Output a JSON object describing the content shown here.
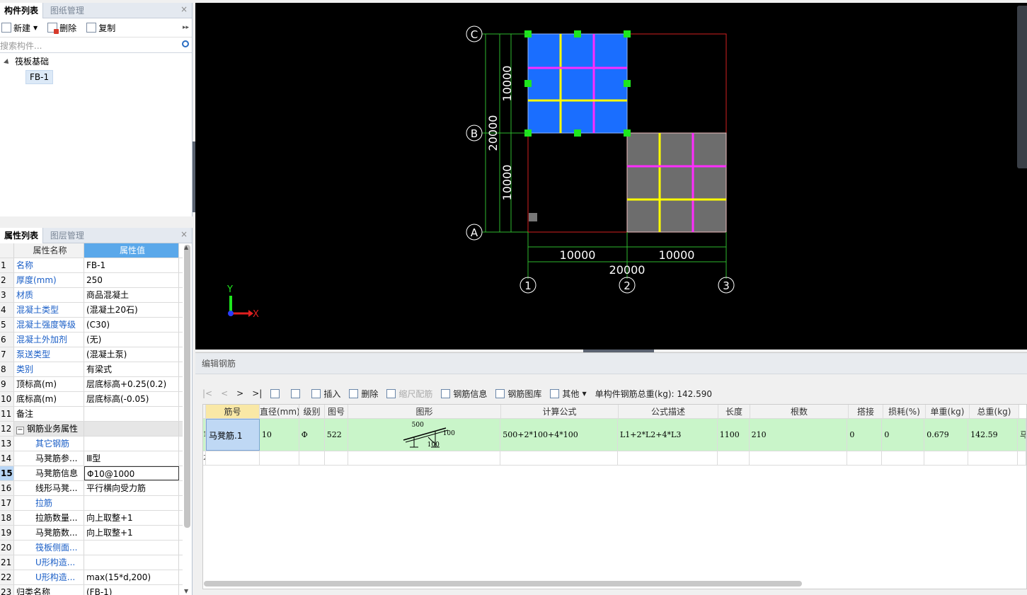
{
  "component_panel": {
    "tabs": [
      "构件列表",
      "图纸管理"
    ],
    "toolbar": {
      "new": "新建",
      "delete": "删除",
      "copy": "复制"
    },
    "search_placeholder": "搜索构件...",
    "tree": {
      "root": "筏板基础",
      "child": "FB-1"
    }
  },
  "property_panel": {
    "tabs": [
      "属性列表",
      "图层管理"
    ],
    "header": {
      "name": "属性名称",
      "value": "属性值"
    },
    "rows": [
      {
        "num": "1",
        "name": "名称",
        "value": "FB-1"
      },
      {
        "num": "2",
        "name": "厚度(mm)",
        "value": "250"
      },
      {
        "num": "3",
        "name": "材质",
        "value": "商品混凝土"
      },
      {
        "num": "4",
        "name": "混凝土类型",
        "value": "(混凝土20石)"
      },
      {
        "num": "5",
        "name": "混凝土强度等级",
        "value": "(C30)"
      },
      {
        "num": "6",
        "name": "混凝土外加剂",
        "value": "(无)"
      },
      {
        "num": "7",
        "name": "泵送类型",
        "value": "(混凝土泵)"
      },
      {
        "num": "8",
        "name": "类别",
        "value": "有梁式"
      },
      {
        "num": "9",
        "name": "顶标高(m)",
        "value": "层底标高+0.25(0.2)"
      },
      {
        "num": "10",
        "name": "底标高(m)",
        "value": "层底标高(-0.05)"
      },
      {
        "num": "11",
        "name": "备注",
        "value": ""
      },
      {
        "num": "12",
        "name": "钢筋业务属性",
        "value": ""
      },
      {
        "num": "13",
        "name": "其它钢筋",
        "value": ""
      },
      {
        "num": "14",
        "name": "马凳筋参...",
        "value": "Ⅲ型"
      },
      {
        "num": "15",
        "name": "马凳筋信息",
        "value": "Φ10@1000"
      },
      {
        "num": "16",
        "name": "线形马凳...",
        "value": "平行横向受力筋"
      },
      {
        "num": "17",
        "name": "拉筋",
        "value": ""
      },
      {
        "num": "18",
        "name": "拉筋数量...",
        "value": "向上取整+1"
      },
      {
        "num": "19",
        "name": "马凳筋数...",
        "value": "向上取整+1"
      },
      {
        "num": "20",
        "name": "筏板侧面...",
        "value": ""
      },
      {
        "num": "21",
        "name": "U形构造...",
        "value": ""
      },
      {
        "num": "22",
        "name": "U形构造...",
        "value": "max(15*d,200)"
      },
      {
        "num": "23",
        "name": "归类名称",
        "value": "(FB-1)"
      }
    ]
  },
  "canvas": {
    "axis_rows": [
      "C",
      "B",
      "A"
    ],
    "axis_cols": [
      "1",
      "2",
      "3"
    ],
    "dims_vertical": [
      "10000",
      "10000",
      "20000"
    ],
    "dims_horizontal": [
      "10000",
      "10000",
      "20000"
    ],
    "axis_x": "X",
    "axis_y": "Y"
  },
  "editor": {
    "title": "编辑钢筋",
    "toolbar": {
      "insert": "插入",
      "delete": "删除",
      "scale": "缩尺配筋",
      "info": "钢筋信息",
      "library": "钢筋图库",
      "other": "其他",
      "total_label": "单构件钢筋总重(kg): 142.590"
    },
    "columns": [
      "筋号",
      "直径(mm)",
      "级别",
      "图号",
      "图形",
      "计算公式",
      "公式描述",
      "长度",
      "根数",
      "搭接",
      "损耗(%)",
      "单重(kg)",
      "总重(kg)"
    ],
    "rows": [
      {
        "num": "1",
        "name": "马凳筋.1",
        "dia": "10",
        "grade": "Φ",
        "fig": "522",
        "shape_top": "500",
        "shape_right": "100",
        "shape_bottom": "100",
        "formula": "500+2*100+4*100",
        "desc": "L1+2*L2+4*L3",
        "length": "1100",
        "count": "210",
        "lap": "0",
        "loss": "0",
        "unit": "0.679",
        "total": "142.59",
        "extra": "马"
      },
      {
        "num": "2"
      }
    ]
  }
}
